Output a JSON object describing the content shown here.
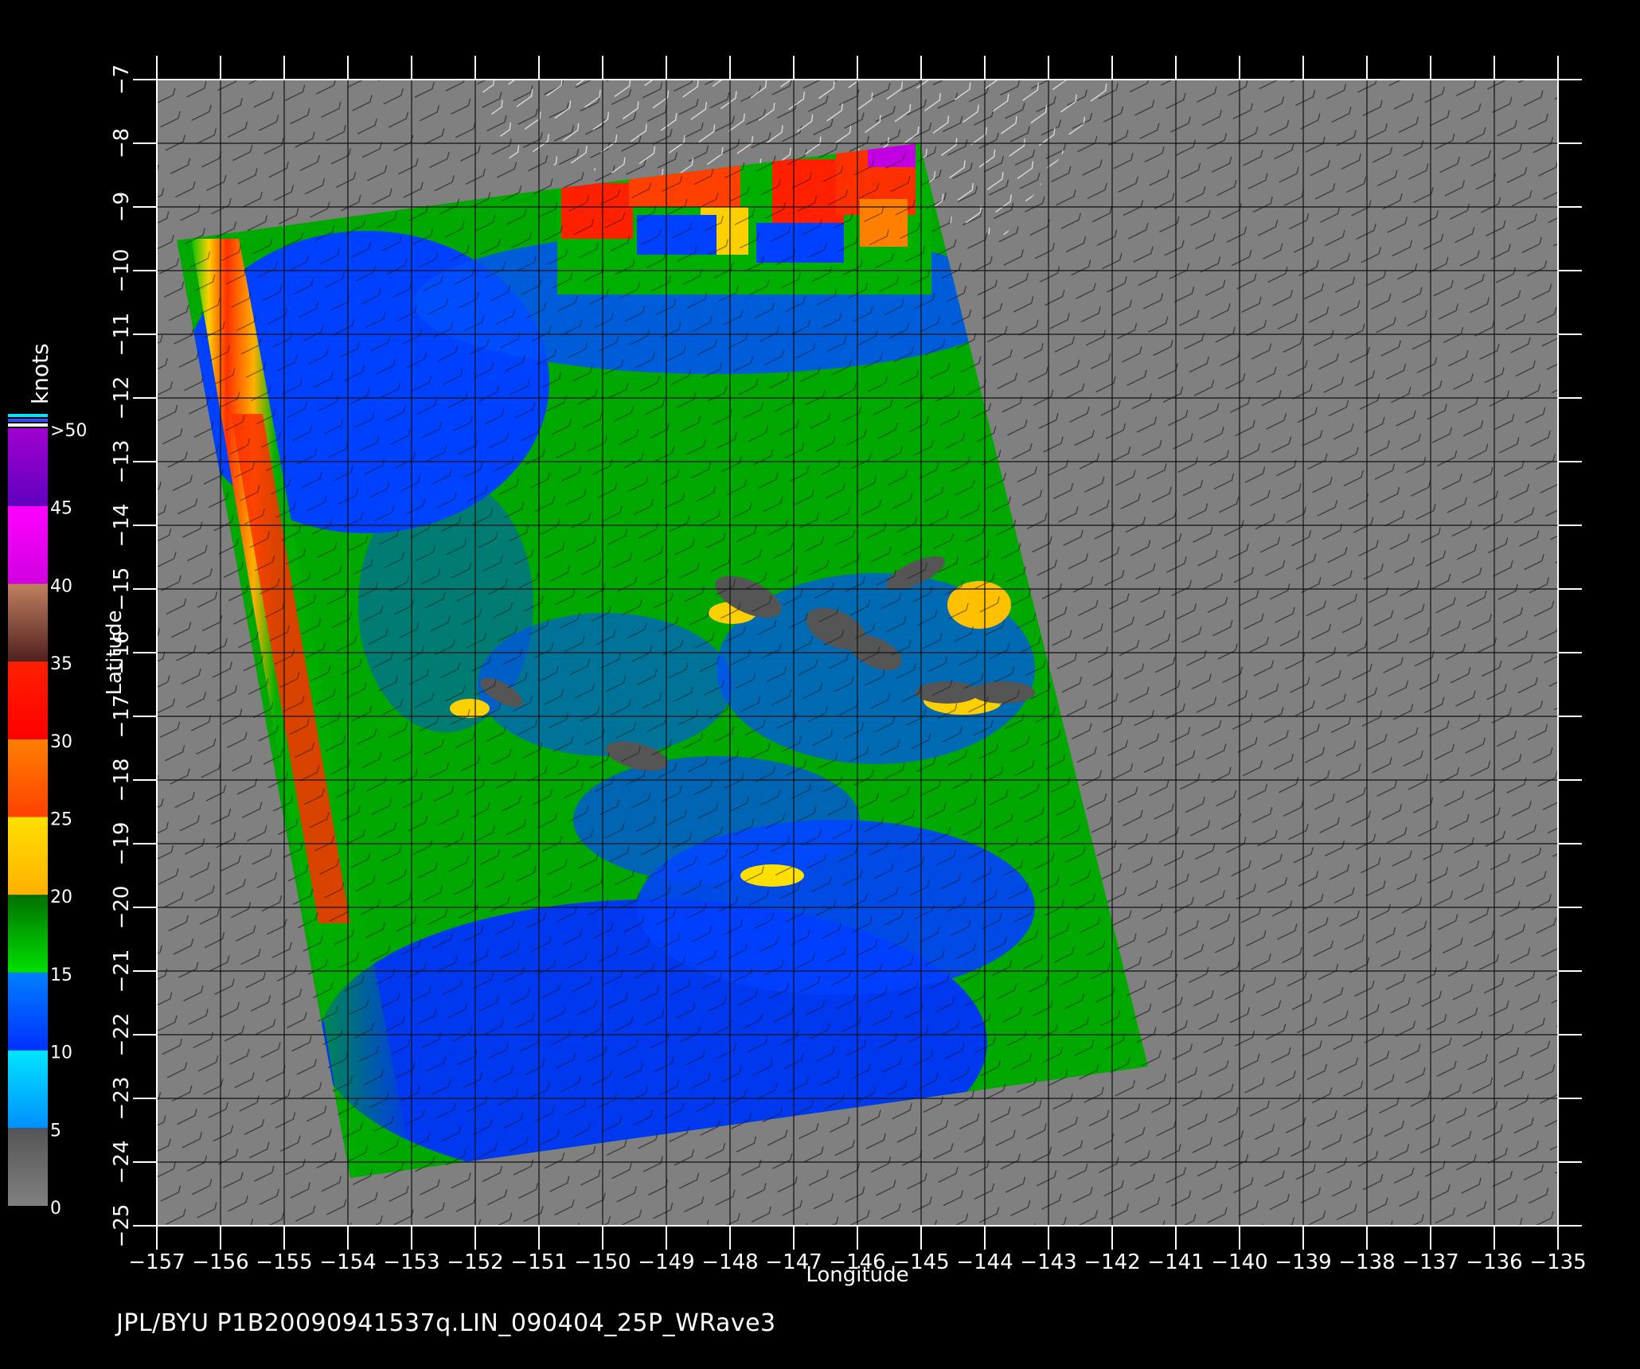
{
  "axes": {
    "xlabel": "Longitude",
    "ylabel": "Latitude",
    "x_ticks": [
      "−157",
      "−156",
      "−155",
      "−154",
      "−153",
      "−152",
      "−151",
      "−150",
      "−149",
      "−148",
      "−147",
      "−146",
      "−145",
      "−144",
      "−143",
      "−142",
      "−141",
      "−140",
      "−139",
      "−138",
      "−137",
      "−136",
      "−135"
    ],
    "y_ticks": [
      "−7",
      "−8",
      "−9",
      "−10",
      "−11",
      "−12",
      "−13",
      "−14",
      "−15",
      "−16",
      "−17",
      "−18",
      "−19",
      "−20",
      "−21",
      "−22",
      "−23",
      "−24",
      "−25"
    ],
    "x_range": [
      -157,
      -135
    ],
    "y_range": [
      -25,
      -7
    ]
  },
  "colorbar": {
    "unit": "knots",
    "labels": [
      ">50",
      "45",
      "40",
      "35",
      "30",
      "25",
      "20",
      "15",
      "10",
      "5",
      "0"
    ],
    "segments": [
      {
        "from": 0,
        "to": 5,
        "color_top": "#555555",
        "color_bottom": "#808080"
      },
      {
        "from": 5,
        "to": 10,
        "color_top": "#00e5ff",
        "color_bottom": "#0090ff"
      },
      {
        "from": 10,
        "to": 15,
        "color_top": "#0080ff",
        "color_bottom": "#0030ff"
      },
      {
        "from": 15,
        "to": 20,
        "color_top": "#007000",
        "color_bottom": "#00e000"
      },
      {
        "from": 20,
        "to": 25,
        "color_top": "#ffe000",
        "color_bottom": "#ffb000"
      },
      {
        "from": 25,
        "to": 30,
        "color_top": "#ff8000",
        "color_bottom": "#ff4000"
      },
      {
        "from": 30,
        "to": 35,
        "color_top": "#ff2000",
        "color_bottom": "#ff0000"
      },
      {
        "from": 35,
        "to": 40,
        "color_top": "#c08060",
        "color_bottom": "#502020"
      },
      {
        "from": 40,
        "to": 45,
        "color_top": "#ff00ff",
        "color_bottom": "#d000e0"
      },
      {
        "from": 45,
        "to": 50,
        "color_top": "#a000d0",
        "color_bottom": "#6000c0"
      }
    ]
  },
  "footer_text": "JPL/BYU  P1B20090941537q.LIN_090404_25P_WRave3",
  "colors": {
    "background": "#000000",
    "plot_gray": "#808080",
    "wind_low": "#0030ff",
    "wind_mid": "#00b000",
    "wind_high": "#ff3000"
  }
}
